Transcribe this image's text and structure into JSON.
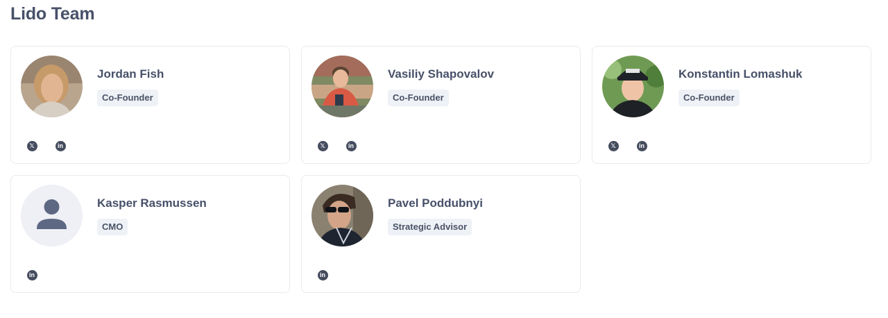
{
  "page": {
    "title": "Lido Team"
  },
  "members": [
    {
      "name": "Jordan Fish",
      "role": "Co-Founder",
      "socials": [
        "x",
        "linkedin"
      ]
    },
    {
      "name": "Vasiliy Shapovalov",
      "role": "Co-Founder",
      "socials": [
        "x",
        "linkedin"
      ]
    },
    {
      "name": "Konstantin Lomashuk",
      "role": "Co-Founder",
      "socials": [
        "x",
        "linkedin"
      ]
    },
    {
      "name": "Kasper Rasmussen",
      "role": "CMO",
      "socials": [
        "linkedin"
      ]
    },
    {
      "name": "Pavel Poddubnyi",
      "role": "Strategic Advisor",
      "socials": [
        "linkedin"
      ]
    }
  ],
  "icons": {
    "x": "x-icon",
    "linkedin": "linkedin-icon",
    "placeholder_avatar": "user-placeholder-icon"
  },
  "colors": {
    "text": "#475069",
    "badge_bg": "#eef1f6",
    "card_border": "#e7eaf0",
    "icon": "#454c5e"
  }
}
